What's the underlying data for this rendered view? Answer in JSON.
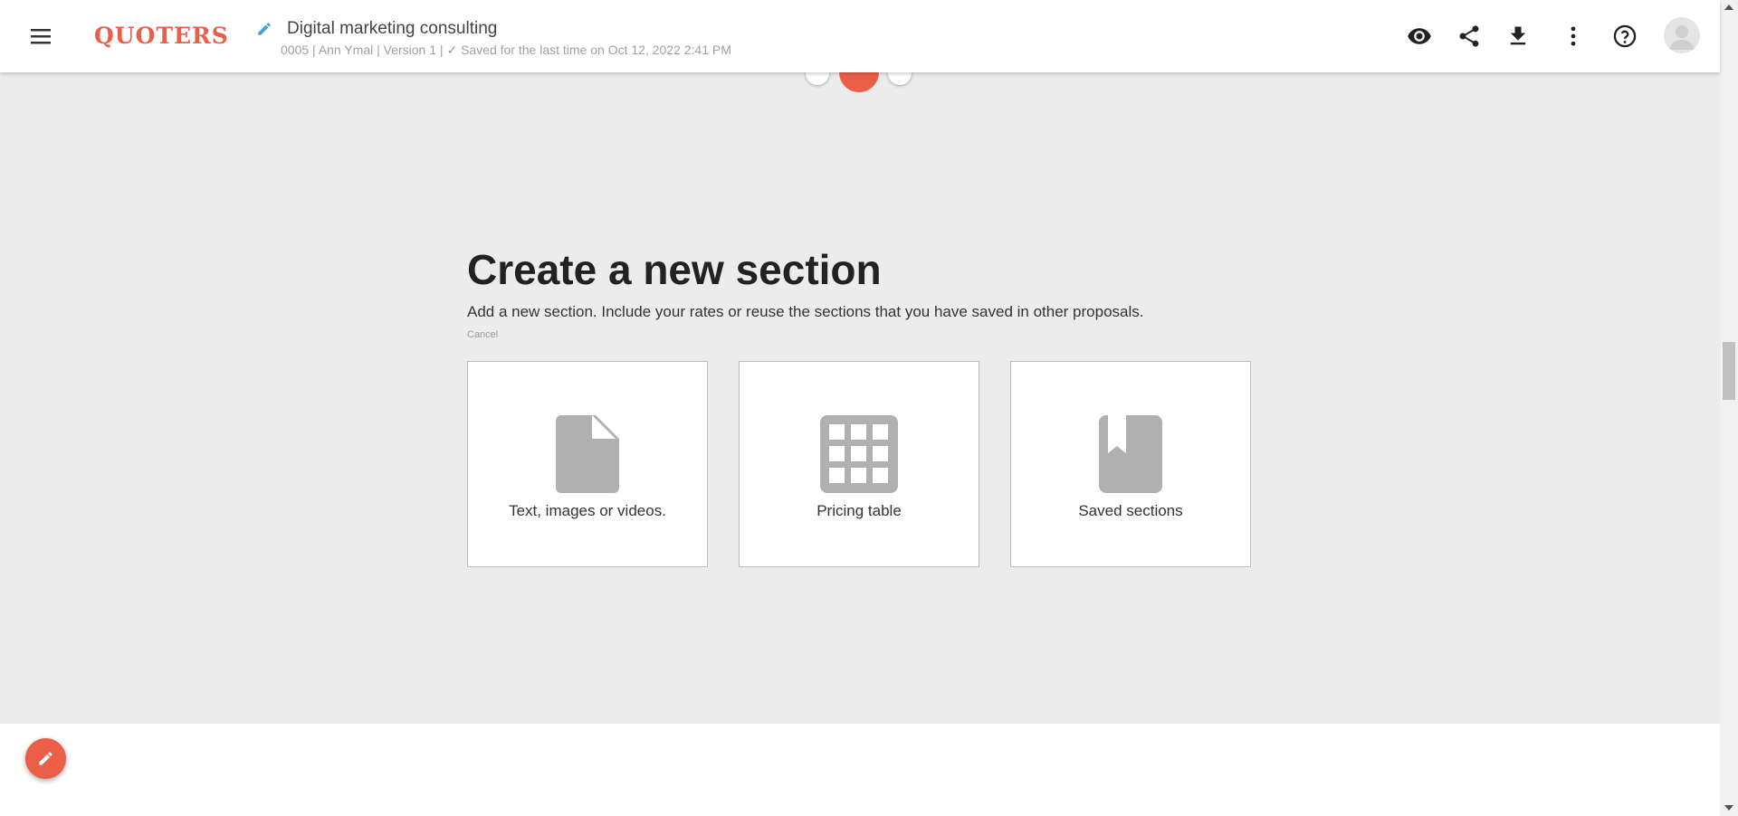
{
  "header": {
    "logo_text": "QUOTERS",
    "doc_title": "Digital marketing consulting",
    "doc_meta_prefix": "0005 | Ann Ymal | Version 1 |",
    "doc_meta_check": "✓",
    "doc_meta_saved": "Saved for the last time on Oct 12, 2022 2:41 PM",
    "icons": [
      "menu-icon",
      "edit-icon",
      "eye-icon",
      "share-icon",
      "download-icon",
      "more-vert-icon",
      "help-icon",
      "avatar-icon"
    ]
  },
  "section": {
    "heading": "Create a new section",
    "description": "Add a new section. Include your rates or reuse the sections that you have saved in other proposals.",
    "cancel_label": "Cancel",
    "cards": [
      {
        "label": "Text, images or videos.",
        "icon": "document-icon"
      },
      {
        "label": "Pricing table",
        "icon": "grid-icon"
      },
      {
        "label": "Saved sections",
        "icon": "bookmark-icon"
      }
    ]
  },
  "colors": {
    "accent": "#eb5e47",
    "background": "#ececec",
    "card_icon": "#b0b0b0",
    "edit_pencil": "#4a9fd8"
  },
  "fab": {
    "icon": "pencil-icon"
  }
}
